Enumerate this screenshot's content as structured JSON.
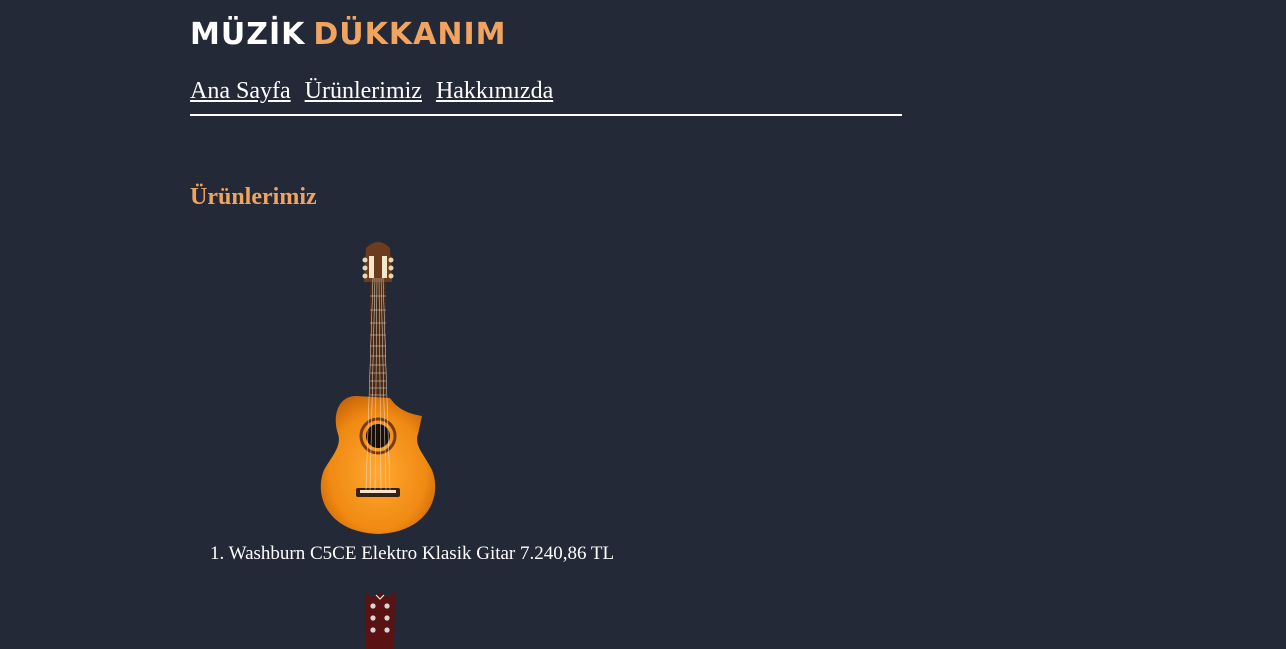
{
  "logo": {
    "word1": "MÜZİK",
    "word2": "DÜKKANIM",
    "accent_color": "#f0a460"
  },
  "nav": {
    "items": [
      {
        "label": "Ana Sayfa"
      },
      {
        "label": "Ürünlerimiz"
      },
      {
        "label": "Hakkımızda"
      }
    ]
  },
  "page": {
    "section_title": "Ürünlerimiz",
    "background_color": "#242938"
  },
  "products": [
    {
      "number": "1.",
      "name": "Washburn C5CE Elektro Klasik Gitar",
      "price": "7.240,86 TL",
      "image": "classical-guitar-image"
    },
    {
      "image": "electric-guitar-headstock-image"
    }
  ]
}
